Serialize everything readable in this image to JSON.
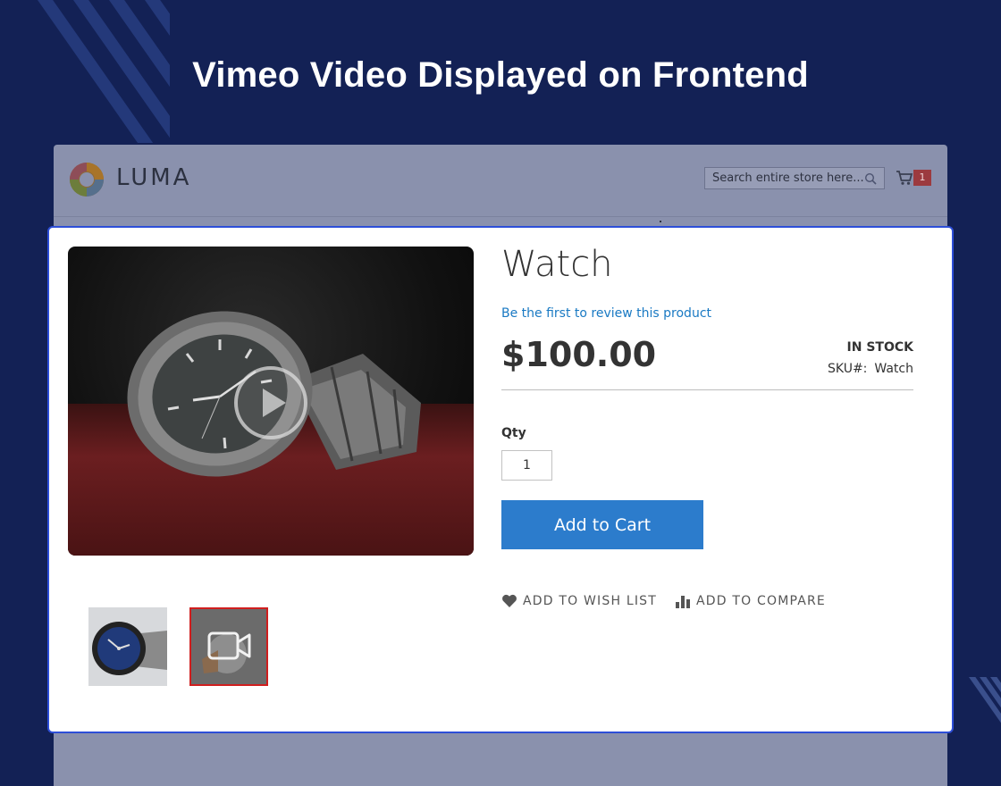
{
  "headline": "Vimeo Video Displayed on Frontend",
  "store": {
    "logo_text": "LUMA",
    "search": {
      "placeholder": "Search entire store here..."
    },
    "cart_count": "1"
  },
  "product": {
    "title": "Watch",
    "review_link": "Be the first to review this product",
    "price": "$100.00",
    "stock_status": "IN STOCK",
    "sku_label": "SKU#:",
    "sku_value": "Watch",
    "qty_label": "Qty",
    "qty_value": "1",
    "add_to_cart_label": "Add to Cart",
    "wishlist_label": "ADD TO WISH LIST",
    "compare_label": "ADD TO COMPARE"
  },
  "media": {
    "main_icon": "play-icon",
    "thumbnails": [
      {
        "type": "image",
        "selected": false
      },
      {
        "type": "video",
        "selected": true,
        "icon": "video-camera-icon"
      }
    ]
  },
  "colors": {
    "page_bg": "#132155",
    "panel_border": "#2d4ed8",
    "link": "#1979c3",
    "button": "#2c7ccc",
    "selected_thumb_border": "#d01e1e"
  }
}
